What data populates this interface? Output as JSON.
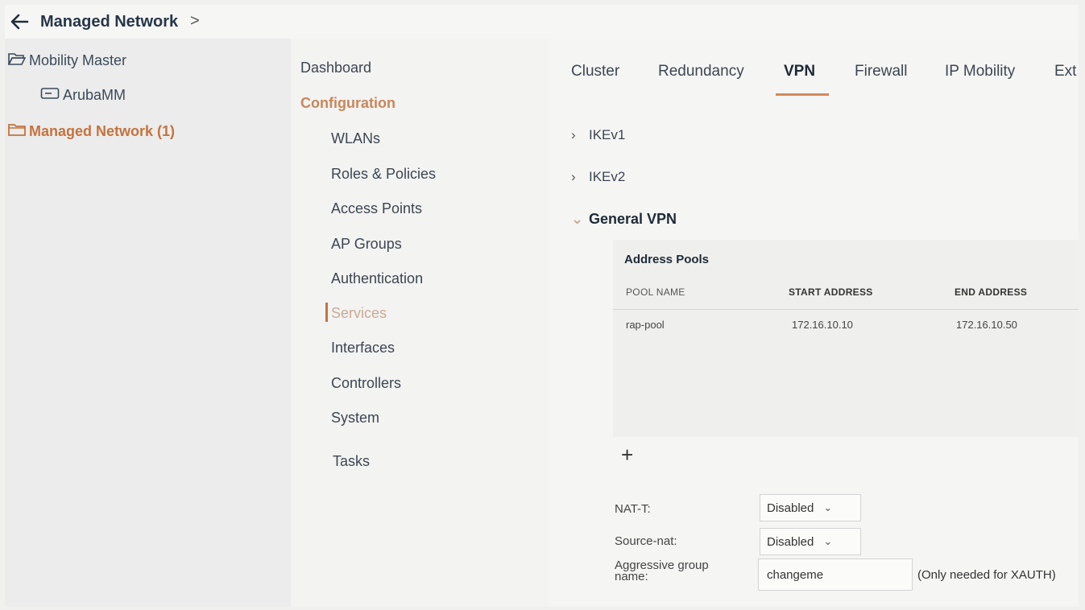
{
  "header": {
    "back_icon": "arrow-left-icon",
    "breadcrumb": "Managed Network",
    "breadcrumb_chevron": ">"
  },
  "tree": {
    "items": [
      {
        "label": "Mobility Master",
        "icon": "folder-open-icon"
      },
      {
        "label": "ArubaMM",
        "icon": "controller-device-icon"
      },
      {
        "label": "Managed Network (1)",
        "icon": "folder-icon",
        "accent": "#c4733e"
      }
    ]
  },
  "nav": {
    "dashboard": "Dashboard",
    "configuration": "Configuration",
    "items": [
      "WLANs",
      "Roles & Policies",
      "Access Points",
      "AP Groups",
      "Authentication",
      "Services",
      "Interfaces",
      "Controllers",
      "System"
    ],
    "tasks": "Tasks",
    "active": "Services"
  },
  "tabs": {
    "items": [
      "Cluster",
      "Redundancy",
      "VPN",
      "Firewall",
      "IP Mobility",
      "Ext"
    ],
    "active": "VPN",
    "accent": "#d28a5a"
  },
  "accordion": {
    "ikev1": "IKEv1",
    "ikev2": "IKEv2",
    "general": "General VPN"
  },
  "address_pools": {
    "title": "Address Pools",
    "columns": [
      "POOL NAME",
      "START ADDRESS",
      "END ADDRESS"
    ],
    "rows": [
      [
        "rap-pool",
        "172.16.10.10",
        "172.16.10.50"
      ]
    ],
    "add_symbol": "+"
  },
  "form": {
    "nat_t": {
      "label": "NAT-T:",
      "value": "Disabled"
    },
    "source_nat": {
      "label": "Source-nat:",
      "value": "Disabled"
    },
    "aggressive": {
      "label_line1": "Aggressive group",
      "label_line2": "name:",
      "value": "changeme",
      "hint": "(Only needed for XAUTH)"
    }
  }
}
